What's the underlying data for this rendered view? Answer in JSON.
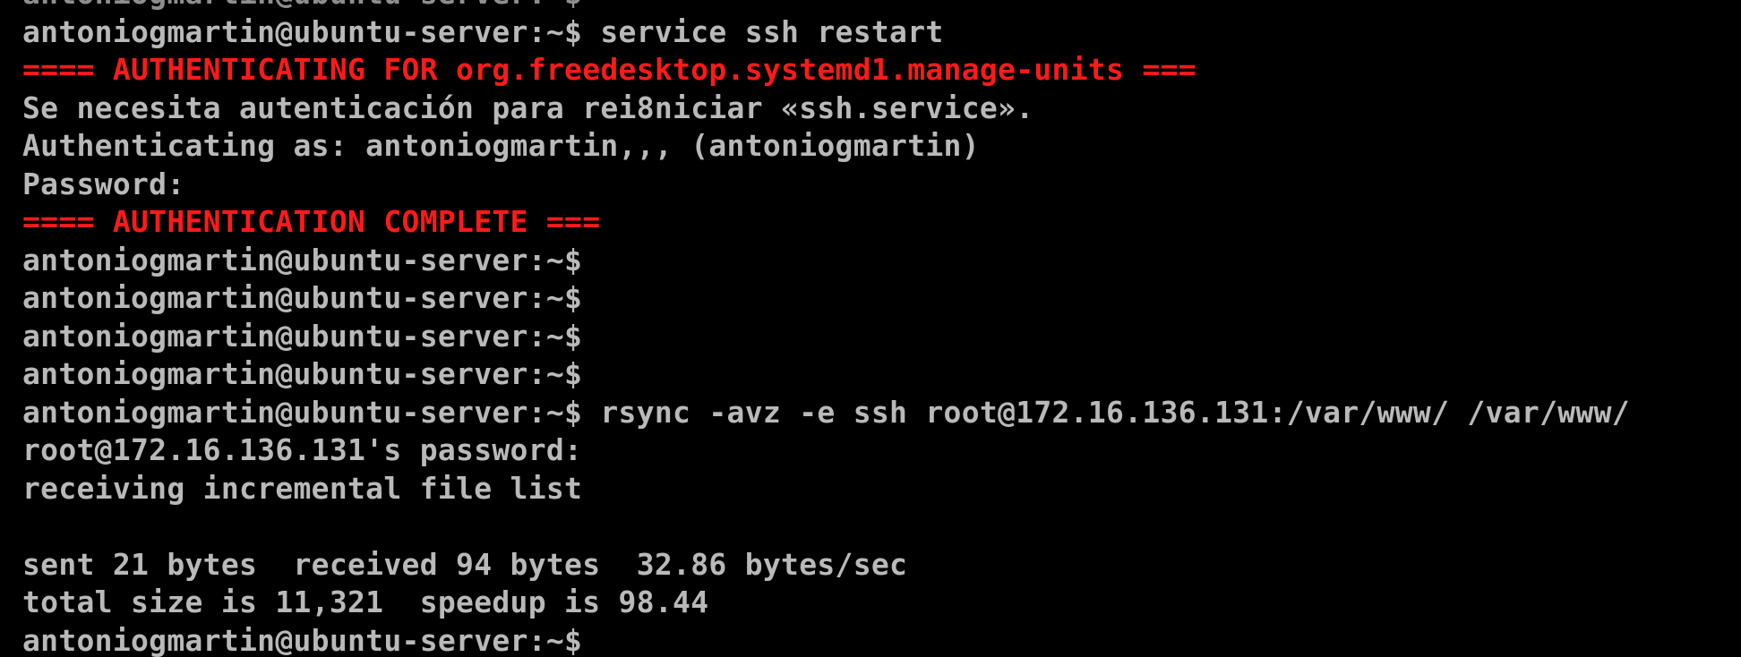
{
  "terminal": {
    "colors": {
      "background": "#000000",
      "text": "#b9b9b9",
      "auth_banner": "#ff1a1a"
    },
    "lines": [
      {
        "text": "antoniogmartin@ubuntu-server:~$",
        "style": "clipped"
      },
      {
        "text": "antoniogmartin@ubuntu-server:~$ service ssh restart",
        "style": "normal"
      },
      {
        "text": "==== AUTHENTICATING FOR org.freedesktop.systemd1.manage-units ===",
        "style": "red"
      },
      {
        "text": "Se necesita autenticación para rei8niciar «ssh.service».",
        "style": "normal"
      },
      {
        "text": "Authenticating as: antoniogmartin,,, (antoniogmartin)",
        "style": "normal"
      },
      {
        "text": "Password:",
        "style": "normal"
      },
      {
        "text": "==== AUTHENTICATION COMPLETE ===",
        "style": "red"
      },
      {
        "text": "antoniogmartin@ubuntu-server:~$",
        "style": "normal"
      },
      {
        "text": "antoniogmartin@ubuntu-server:~$",
        "style": "normal"
      },
      {
        "text": "antoniogmartin@ubuntu-server:~$",
        "style": "normal"
      },
      {
        "text": "antoniogmartin@ubuntu-server:~$",
        "style": "normal"
      },
      {
        "text": "antoniogmartin@ubuntu-server:~$ rsync -avz -e ssh root@172.16.136.131:/var/www/ /var/www/",
        "style": "normal"
      },
      {
        "text": "root@172.16.136.131's password:",
        "style": "normal"
      },
      {
        "text": "receiving incremental file list",
        "style": "normal"
      },
      {
        "text": "",
        "style": "blank"
      },
      {
        "text": "sent 21 bytes  received 94 bytes  32.86 bytes/sec",
        "style": "normal"
      },
      {
        "text": "total size is 11,321  speedup is 98.44",
        "style": "normal"
      },
      {
        "text": "antoniogmartin@ubuntu-server:~$",
        "style": "normal"
      }
    ]
  }
}
